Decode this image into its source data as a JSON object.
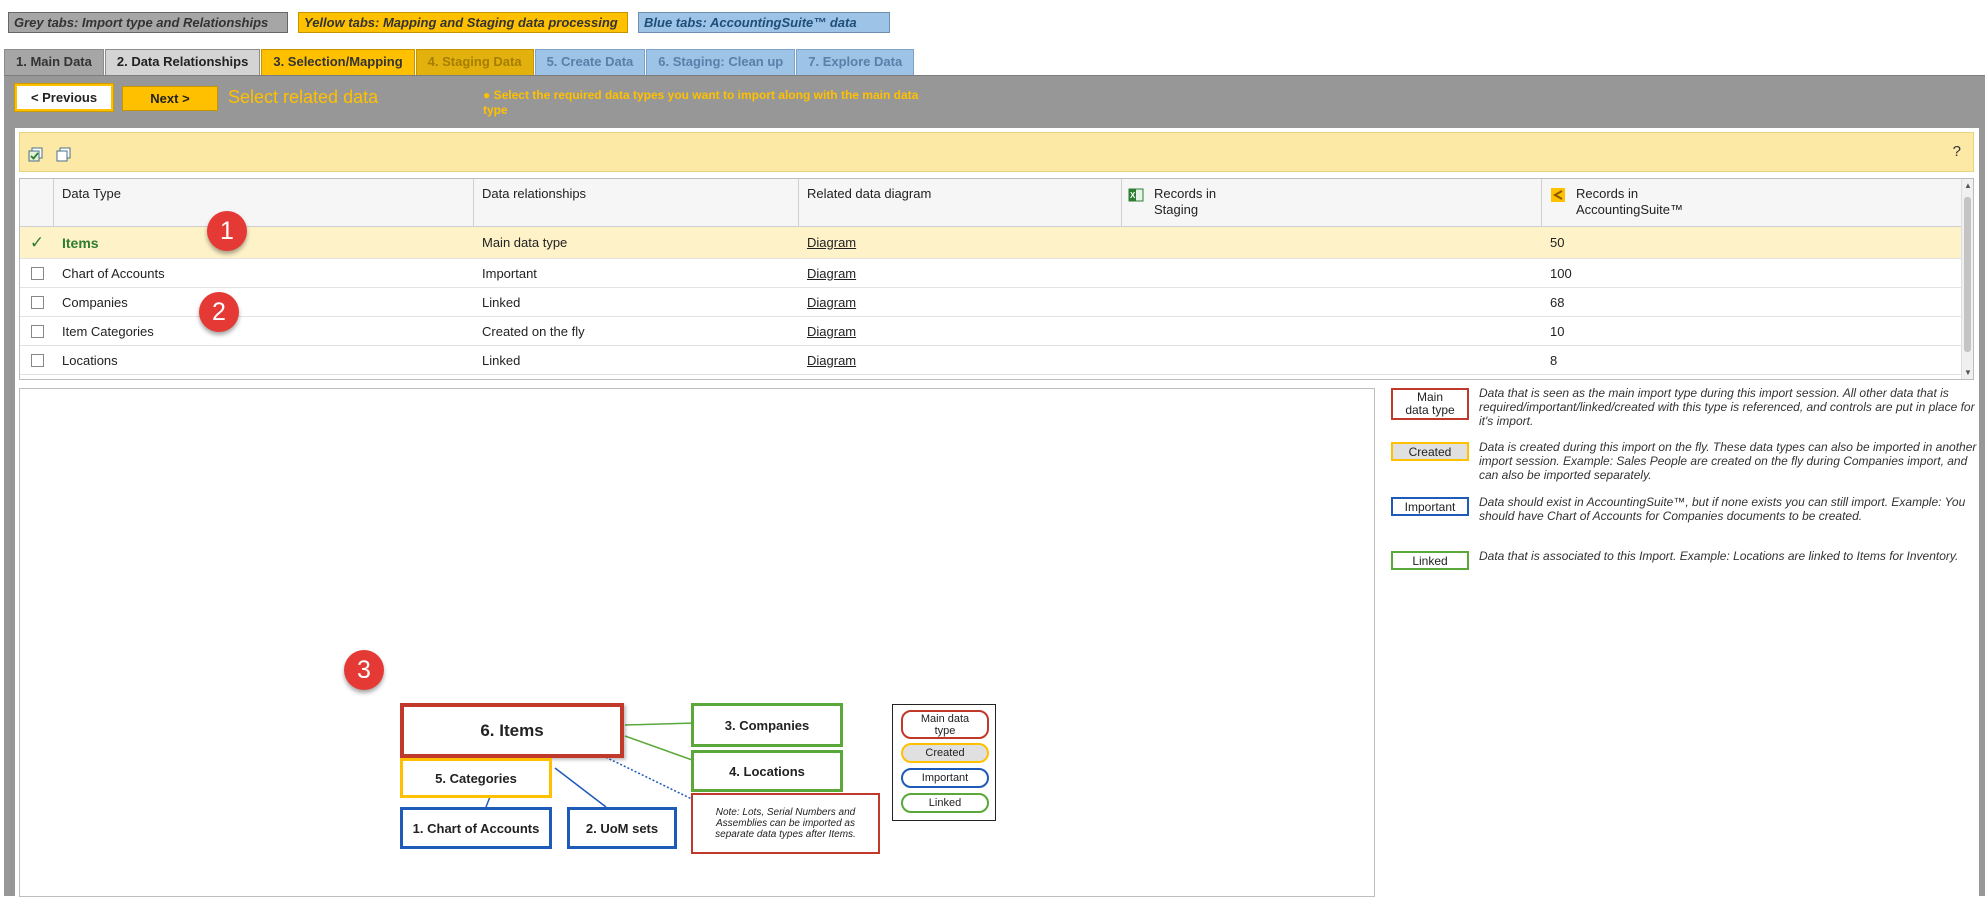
{
  "legend": {
    "grey": "Grey tabs: Import type and Relationships",
    "yellow": "Yellow tabs: Mapping and Staging data processing",
    "blue": "Blue tabs: AccountingSuite™ data"
  },
  "tabs": [
    {
      "label": "1. Main Data"
    },
    {
      "label": "2. Data Relationships"
    },
    {
      "label": "3. Selection/Mapping"
    },
    {
      "label": "4. Staging Data"
    },
    {
      "label": "5. Create Data"
    },
    {
      "label": "6. Staging: Clean up"
    },
    {
      "label": "7. Explore Data"
    }
  ],
  "nav": {
    "prev": "< Previous",
    "next": "Next >",
    "title": "Select related data",
    "hint": "● Select the required data types you want to import along with the main data type"
  },
  "toolbar": {
    "help": "?"
  },
  "grid": {
    "headers": {
      "data_type": "Data Type",
      "relationships": "Data relationships",
      "diagram": "Related data diagram",
      "staging": "Records in Staging",
      "suite": "Records in AccountingSuite™"
    },
    "rows": [
      {
        "type": "Items",
        "rel": "Main data type",
        "diagram": "Diagram",
        "staging": "",
        "suite": "50",
        "selected": true
      },
      {
        "type": "Chart of Accounts",
        "rel": "Important",
        "diagram": "Diagram",
        "staging": "",
        "suite": "100",
        "selected": false
      },
      {
        "type": "Companies",
        "rel": "Linked",
        "diagram": "Diagram",
        "staging": "",
        "suite": "68",
        "selected": false
      },
      {
        "type": "Item Categories",
        "rel": "Created on the fly",
        "diagram": "Diagram",
        "staging": "",
        "suite": "10",
        "selected": false
      },
      {
        "type": "Locations",
        "rel": "Linked",
        "diagram": "Diagram",
        "staging": "",
        "suite": "8",
        "selected": false
      }
    ],
    "checkmark": "✓"
  },
  "key": [
    {
      "badge": "Main data type",
      "text": "Data that is seen as the main import type during this import session. All other data that is required/important/linked/created with this type is referenced, and controls are put in place for it's import.",
      "color": "#c0392b"
    },
    {
      "badge": "Created",
      "text": "Data is created during this import on the fly. These data types can also be imported in another import session. Example: Sales People are created on the fly during Companies import, and can also be imported separately.",
      "color": "#ffc000"
    },
    {
      "badge": "Important",
      "text": "Data should exist in AccountingSuite™, but if none exists you can still import. Example: You should have Chart of Accounts for Companies documents to be created.",
      "color": "#1e5bb8"
    },
    {
      "badge": "Linked",
      "text": "Data that is associated to this Import. Example: Locations are linked to Items for Inventory.",
      "color": "#5aa83a"
    }
  ],
  "diagram": {
    "items": "6. Items",
    "categories": "5. Categories",
    "companies": "3. Companies",
    "locations": "4. Locations",
    "coa": "1. Chart of Accounts",
    "uom": "2. UoM sets",
    "note": "Note: Lots, Serial Numbers and Assemblies can be imported as separate data types after Items.",
    "mini_legend": [
      "Main data type",
      "Created",
      "Important",
      "Linked"
    ]
  },
  "callouts": [
    "1",
    "2",
    "3"
  ],
  "colors": {
    "accent": "#ffc000",
    "panel": "#979797",
    "callout": "#e53935"
  }
}
